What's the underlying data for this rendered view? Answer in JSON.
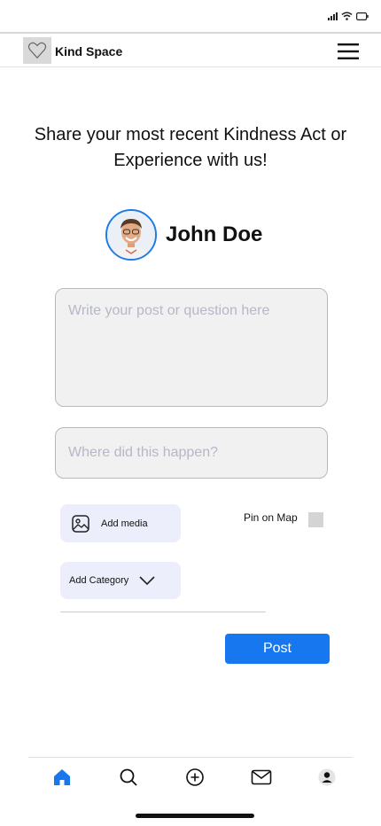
{
  "app": {
    "title": "Kind Space"
  },
  "header": {
    "logo_icon": "heart-outline-icon",
    "menu_icon": "hamburger-menu-icon"
  },
  "status_bar": {
    "icons": [
      "signal-icon",
      "wifi-icon",
      "battery-icon"
    ]
  },
  "prompt": {
    "text": "Share your most recent Kindness Act or Experience with us!"
  },
  "user": {
    "name": "John Doe",
    "avatar_icon": "avatar-photo"
  },
  "form": {
    "post_placeholder": "Write your post or question here",
    "post_value": "",
    "location_placeholder": "Where did this happen?",
    "location_value": "",
    "add_media_label": "Add media",
    "add_category_label": "Add Category",
    "pin_label": "Pin on Map",
    "pin_checked": false,
    "post_button_label": "Post"
  },
  "bottom_nav": {
    "items": [
      {
        "name": "home",
        "icon": "home-icon",
        "active": true
      },
      {
        "name": "search",
        "icon": "search-icon",
        "active": false
      },
      {
        "name": "create",
        "icon": "plus-circle-icon",
        "active": false
      },
      {
        "name": "messages",
        "icon": "mail-icon",
        "active": false
      },
      {
        "name": "profile",
        "icon": "user-icon",
        "active": false
      }
    ]
  },
  "colors": {
    "accent": "#1677ee",
    "chip_bg": "#edeefb",
    "field_bg": "#f1f1f1"
  }
}
